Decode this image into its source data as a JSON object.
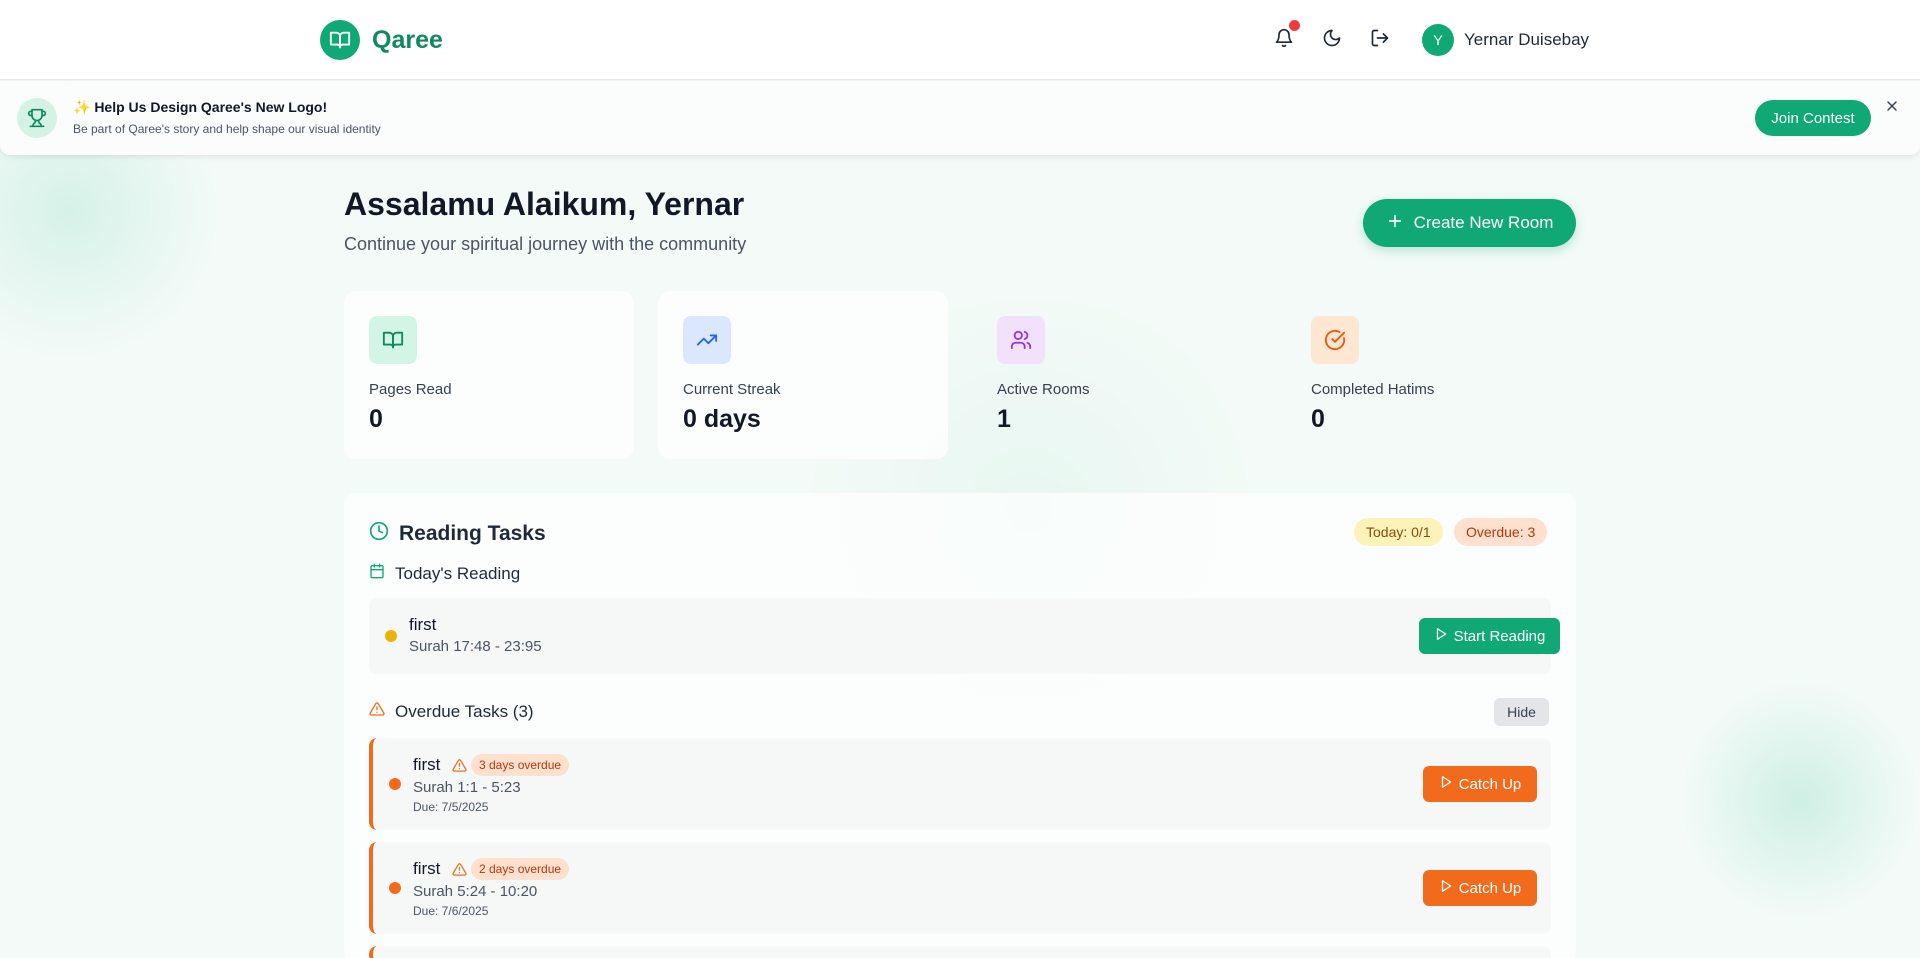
{
  "app": {
    "name": "Qaree",
    "logo_icon": "book-open-icon"
  },
  "header": {
    "icons": [
      "bell-icon",
      "moon-icon",
      "logout-icon"
    ],
    "user": {
      "initial": "Y",
      "name": "Yernar Duisebay"
    }
  },
  "banner": {
    "title": "✨ Help Us Design Qaree's New Logo!",
    "subtitle": "Be part of Qaree's story and help shape our visual identity",
    "button": "Join Contest",
    "icon": "trophy-icon"
  },
  "welcome": {
    "title": "Assalamu Alaikum, Yernar",
    "subtitle": "Continue your spiritual journey with the community",
    "create_button": "Create New Room"
  },
  "stats": [
    {
      "label": "Pages Read",
      "value": "0",
      "icon": "book-open-icon",
      "bg": "#d3f5e6",
      "fg": "#0f8a5f"
    },
    {
      "label": "Current Streak",
      "value": "0 days",
      "icon": "trending-up-icon",
      "bg": "#dbe7fd",
      "fg": "#2563eb"
    },
    {
      "label": "Active Rooms",
      "value": "1",
      "icon": "users-icon",
      "bg": "#f1e1fb",
      "fg": "#9333ea"
    },
    {
      "label": "Completed Hatims",
      "value": "0",
      "icon": "circle-check-icon",
      "bg": "#fde7d3",
      "fg": "#ea580c"
    }
  ],
  "tasks": {
    "title": "Reading Tasks",
    "today_pill": "Today: 0/1",
    "overdue_pill": "Overdue: 3",
    "today_heading": "Today's Reading",
    "today_items": [
      {
        "name": "first",
        "range": "Surah 17:48 - 23:95",
        "button": "Start Reading"
      }
    ],
    "overdue_heading": "Overdue Tasks (3)",
    "hide_button": "Hide",
    "overdue_items": [
      {
        "name": "first",
        "badge": "3 days overdue",
        "range": "Surah 1:1 - 5:23",
        "due": "Due: 7/5/2025",
        "button": "Catch Up"
      },
      {
        "name": "first",
        "badge": "2 days overdue",
        "range": "Surah 5:24 - 10:20",
        "due": "Due: 7/6/2025",
        "button": "Catch Up"
      }
    ]
  },
  "colors": {
    "primary": "#10a874",
    "warning": "#f26b1d",
    "today_dot": "#eab308",
    "notification": "#ef3b3b"
  }
}
